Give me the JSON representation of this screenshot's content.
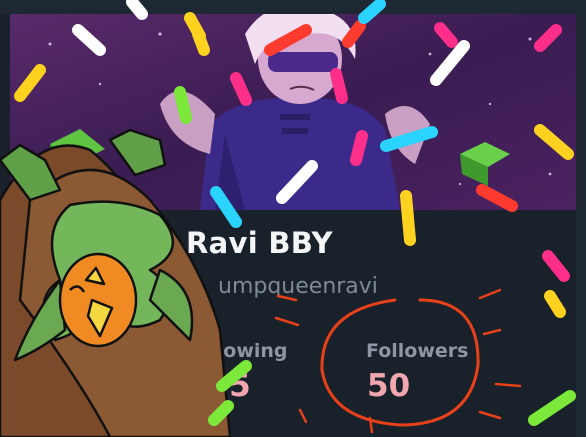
{
  "profile": {
    "display_name": "Ravi BBY",
    "handle": "umpqueenravi"
  },
  "stats": {
    "following_label": "Following",
    "following_value": "155",
    "followers_label": "Followers",
    "followers_value": "50"
  },
  "colors": {
    "card_bg": "#19212b",
    "name_text": "#f4f6f8",
    "muted_text": "#8c96a4",
    "stat_value": "#f2a7b0",
    "circle_annotation": "#e8411a"
  }
}
